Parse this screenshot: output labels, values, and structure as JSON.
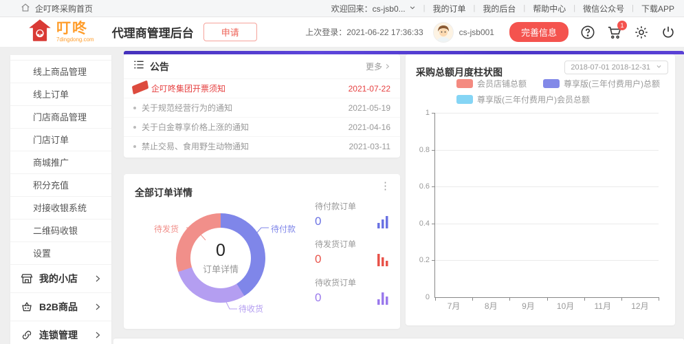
{
  "topbar": {
    "home": "企叮咚采购首页",
    "welcome": "欢迎回来：cs-jsb0...",
    "links": [
      "我的订单",
      "我的后台",
      "帮助中心",
      "微信公众号",
      "下载APP"
    ]
  },
  "header": {
    "logo_text": "叮咚",
    "logo_domain": "7dingdong.com",
    "title": "代理商管理后台",
    "apply_button": "申请",
    "last_login": "上次登录：2021-06-22 17:36:33",
    "username": "cs-jsb001",
    "complete_info_button": "完善信息",
    "cart_badge": "1"
  },
  "sidebar": {
    "items": [
      {
        "label": "线上商品管理"
      },
      {
        "label": "线上订单"
      },
      {
        "label": "门店商品管理"
      },
      {
        "label": "门店订单"
      },
      {
        "label": "商城推广"
      },
      {
        "label": "积分充值"
      },
      {
        "label": "对接收银系统"
      },
      {
        "label": "二维码收银"
      },
      {
        "label": "设置"
      }
    ],
    "sections": [
      {
        "label": "我的小店",
        "icon": "store-icon"
      },
      {
        "label": "B2B商品",
        "icon": "basket-icon"
      },
      {
        "label": "连锁管理",
        "icon": "link-icon"
      }
    ]
  },
  "announcements": {
    "title": "公告",
    "more_label": "更多",
    "items": [
      {
        "text": "企叮咚集团开票须知",
        "date": "2021-07-22",
        "highlight": true
      },
      {
        "text": "关于规范经营行为的通知",
        "date": "2021-05-19"
      },
      {
        "text": "关于白金尊享价格上涨的通知",
        "date": "2021-04-16"
      },
      {
        "text": "禁止交易、食用野生动物通知",
        "date": "2021-03-11"
      }
    ]
  },
  "orders": {
    "title": "全部订单详情",
    "donut": {
      "center_value": "0",
      "center_label": "订单详情",
      "segments": [
        {
          "label": "待付款",
          "color": "#7f86e9",
          "sweep_deg": 148
        },
        {
          "label": "待收货",
          "color": "#b49ef1",
          "sweep_deg": 104
        },
        {
          "label": "待发货",
          "color": "#f18f8a",
          "sweep_deg": 108
        }
      ]
    },
    "stats": [
      {
        "label": "待付款订单",
        "value": "0",
        "color": "#6a72e3"
      },
      {
        "label": "待发货订单",
        "value": "0",
        "color": "#e8534a"
      },
      {
        "label": "待收货订单",
        "value": "0",
        "color": "#9a79ec"
      }
    ]
  },
  "chart_data": {
    "type": "bar",
    "title": "采购总额月度柱状图",
    "date_range": "2018-07-01 2018-12-31",
    "categories": [
      "7月",
      "8月",
      "9月",
      "10月",
      "11月",
      "12月"
    ],
    "series": [
      {
        "name": "会员店铺总额",
        "color": "#f48a80",
        "values": [
          0,
          0,
          0,
          0,
          0,
          0
        ]
      },
      {
        "name": "尊享版(三年付费用户)总额",
        "color": "#8289e8",
        "values": [
          0,
          0,
          0,
          0,
          0,
          0
        ]
      },
      {
        "name": "尊享版(三年付费用户)会员总额",
        "color": "#85d5f5",
        "values": [
          0,
          0,
          0,
          0,
          0,
          0
        ]
      }
    ],
    "ylabel": "",
    "xlabel": "",
    "ylim": [
      0,
      1
    ],
    "yticks": [
      "1",
      "0.8",
      "0.6",
      "0.4",
      "0.2",
      "0"
    ],
    "grid": true,
    "legend_position": "top"
  }
}
